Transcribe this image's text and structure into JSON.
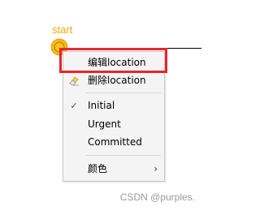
{
  "node": {
    "label": "start",
    "color": "#f3a712"
  },
  "context_menu": {
    "items": [
      {
        "label": "编辑location",
        "icon": "none"
      },
      {
        "label": "删除location",
        "icon": "eraser-icon"
      },
      {
        "label": "Initial",
        "icon": "checkmark-icon",
        "checked": true
      },
      {
        "label": "Urgent",
        "checked": false
      },
      {
        "label": "Committed",
        "checked": false
      },
      {
        "label": "颜色",
        "submenu": true,
        "icon": "chevron-right-icon"
      }
    ],
    "check_glyph": "✓",
    "submenu_glyph": "›"
  },
  "annotation": {
    "highlight_color": "#e8262b"
  },
  "watermark": {
    "text": "CSDN @purples."
  }
}
